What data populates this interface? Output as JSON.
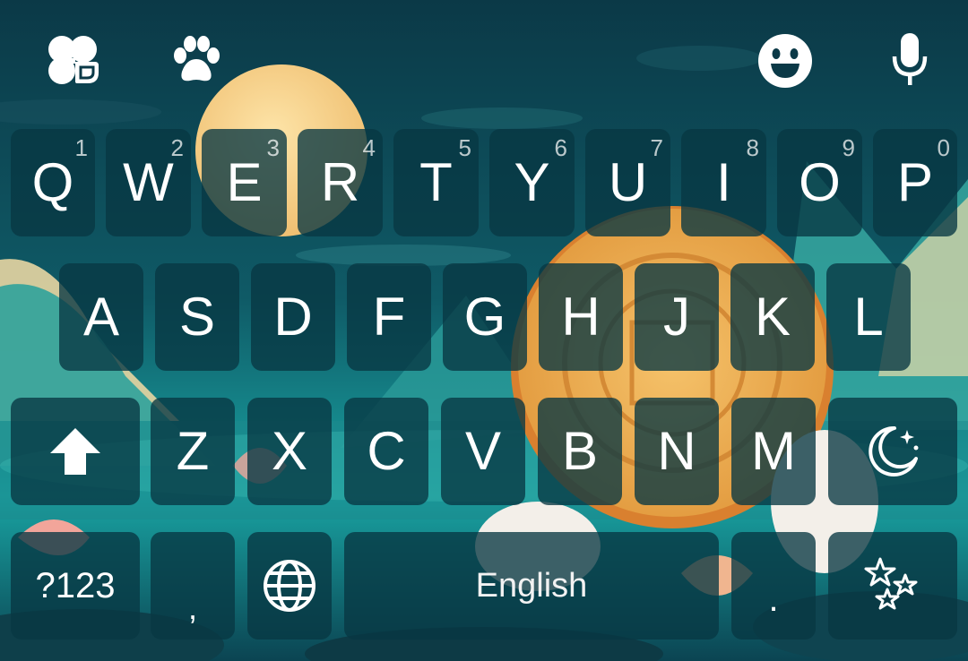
{
  "toolbar": {
    "left_icons": [
      "clover-icon",
      "paw-icon"
    ],
    "right_icons": [
      "emoji-icon",
      "microphone-icon"
    ]
  },
  "keyboard": {
    "row1": [
      {
        "char": "Q",
        "hint": "1"
      },
      {
        "char": "W",
        "hint": "2"
      },
      {
        "char": "E",
        "hint": "3"
      },
      {
        "char": "R",
        "hint": "4"
      },
      {
        "char": "T",
        "hint": "5"
      },
      {
        "char": "Y",
        "hint": "6"
      },
      {
        "char": "U",
        "hint": "7"
      },
      {
        "char": "I",
        "hint": "8"
      },
      {
        "char": "O",
        "hint": "9"
      },
      {
        "char": "P",
        "hint": "0"
      }
    ],
    "row2": [
      "A",
      "S",
      "D",
      "F",
      "G",
      "H",
      "J",
      "K",
      "L"
    ],
    "row3": [
      "Z",
      "X",
      "C",
      "V",
      "B",
      "N",
      "M"
    ],
    "shift_icon": "shift-arrow-icon",
    "moon_icon": "moon-stars-icon",
    "symbols_label": "?123",
    "comma_label": ",",
    "globe_icon": "globe-icon",
    "space_label": "English",
    "period_label": ".",
    "sparkle_icon": "sparkle-stars-icon"
  },
  "colors": {
    "sky_top": "#0b3947",
    "sky_bottom": "#18a7a7",
    "key_fill": "#083742",
    "moon": "#f6d28a",
    "mooncake": "#e9a24a"
  }
}
